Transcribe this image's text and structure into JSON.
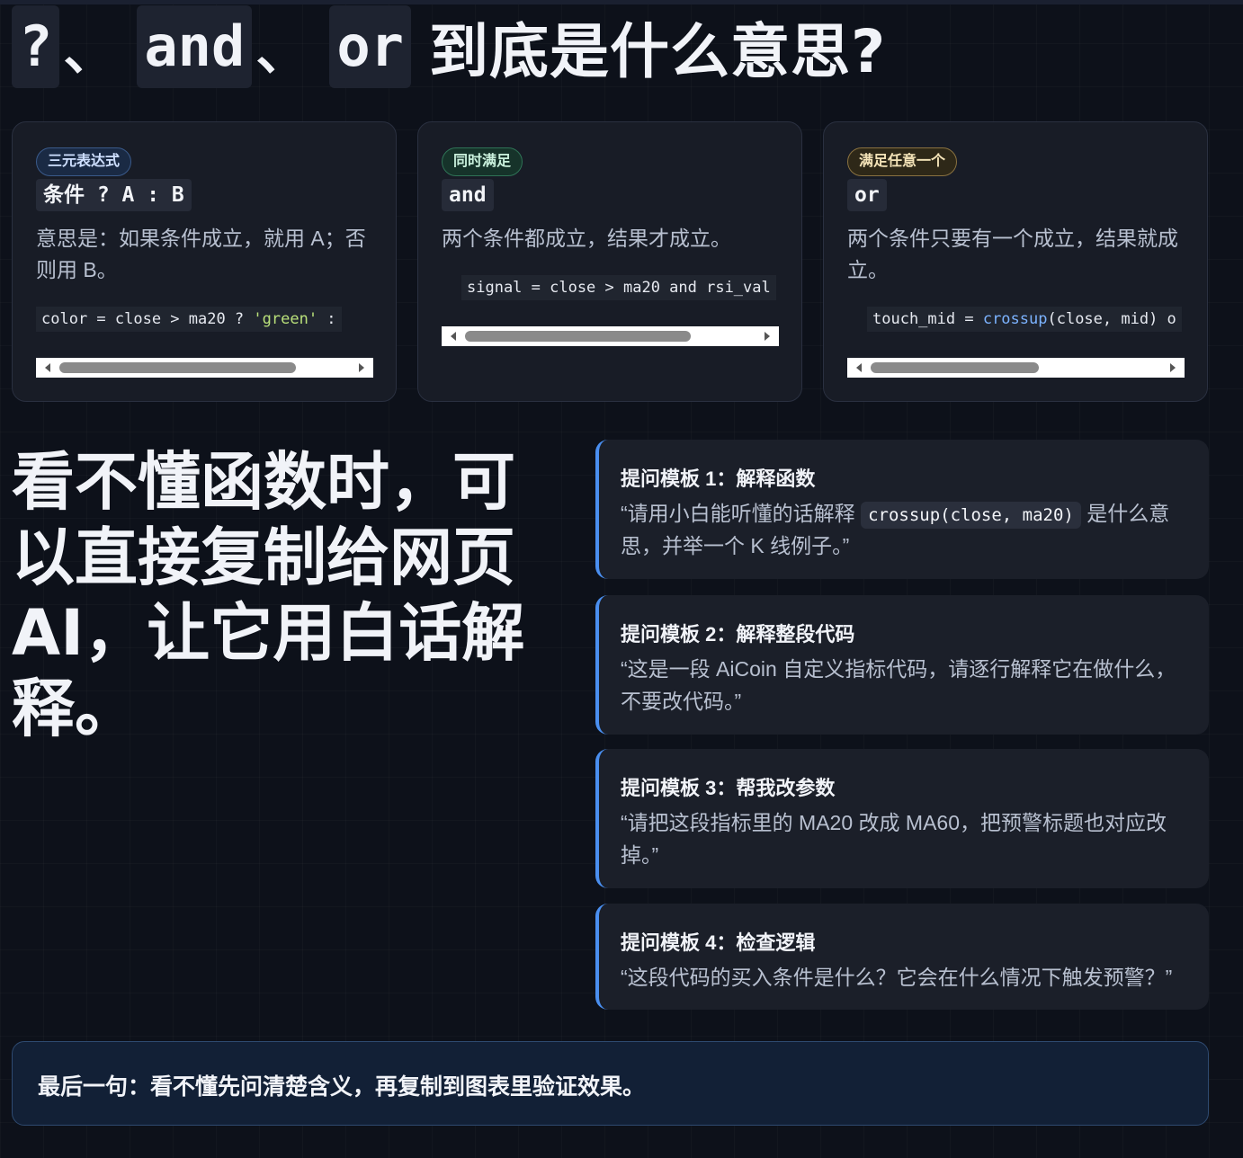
{
  "heading": {
    "kw1": "?",
    "sep1": "、",
    "kw2": "and",
    "sep2": "、",
    "kw3": "or",
    "tail": "到底是什么意思?"
  },
  "cards": [
    {
      "badge": "三元表达式",
      "syntax": "条件 ? A : B",
      "desc": "意思是：如果条件成立，就用 A；否则用 B。",
      "code_prefix": "color = close > ma20 ? ",
      "code_string": "'green'",
      "code_suffix": " :",
      "scroll": 0.7
    },
    {
      "badge": "同时满足",
      "syntax": "and",
      "desc": "两个条件都成立，结果才成立。",
      "code": "signal = close > ma20 and rsi_val",
      "scroll": 0.67
    },
    {
      "badge": "满足任意一个",
      "syntax": "or",
      "desc": "两个条件只要有一个成立，结果就成立。",
      "code_prefix": "touch_mid = ",
      "code_fn": "crossup",
      "code_suffix": "(close, mid) o",
      "scroll": 0.5
    }
  ],
  "bigtext": "看不懂函数时，可以直接复制给网页 AI，让它用白话解释。",
  "templates": [
    {
      "title": "提问模板 1：解释函数",
      "body_before": "“请用小白能听懂的话解释 ",
      "code": "crossup(close, ma20)",
      "body_after": " 是什么意思，并举一个 K 线例子。”"
    },
    {
      "title": "提问模板 2：解释整段代码",
      "body": "“这是一段 AiCoin 自定义指标代码，请逐行解释它在做什么，不要改代码。”"
    },
    {
      "title": "提问模板 3：帮我改参数",
      "body": "“请把这段指标里的 MA20 改成 MA60，把预警标题也对应改掉。”"
    },
    {
      "title": "提问模板 4：检查逻辑",
      "body": "“这段代码的买入条件是什么？它会在什么情况下触发预警？”"
    }
  ],
  "footer": "最后一句：看不懂先问清楚含义，再复制到图表里验证效果。",
  "colors": {
    "background": "#0d111a",
    "card": "#181c26",
    "accent_blue": "#4a8ff0",
    "string_green": "#b9e07a",
    "function_blue": "#7cb3ff"
  }
}
